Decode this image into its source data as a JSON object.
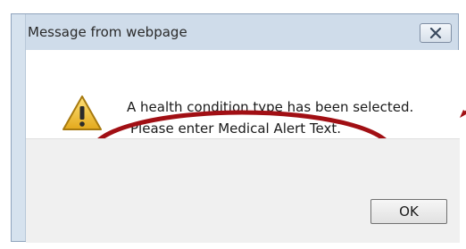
{
  "dialog": {
    "title": "Message from webpage",
    "message_line_1": "A health condition type has been selected.",
    "message_line_2": "Please enter Medical Alert Text.",
    "ok_label": "OK",
    "icons": {
      "close": "close-icon",
      "warning": "warning-icon"
    }
  },
  "colors": {
    "annotation": "#a10f14",
    "title_bar": "#cfdcea",
    "footer": "#f0f0f0",
    "warning_fill": "#f2c230"
  }
}
